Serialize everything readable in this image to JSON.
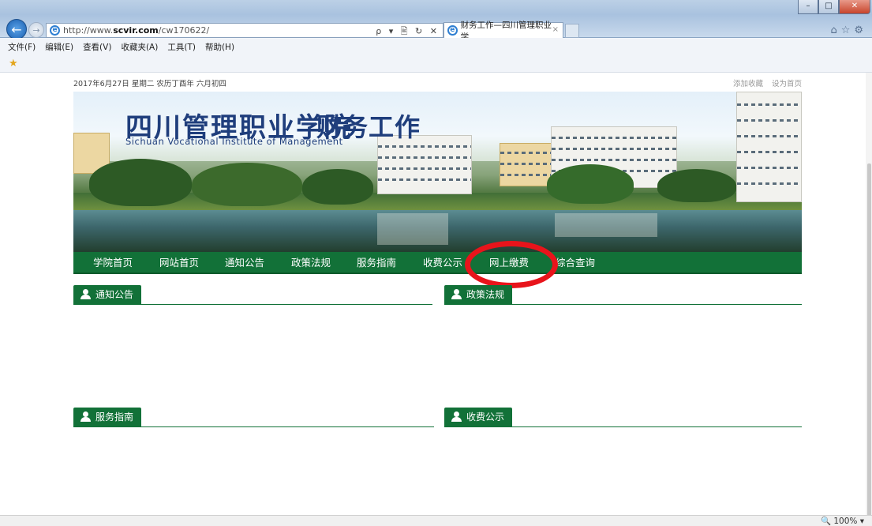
{
  "browser": {
    "url_prefix": "http://www.",
    "url_domain": "scvir.com",
    "url_path": "/cw170622/",
    "address_tools": "ρ ▾ 🖹 ↻ ✕",
    "tab_title": "财务工作—四川管理职业学...",
    "tab_close": "×",
    "menu": [
      "文件(F)",
      "编辑(E)",
      "查看(V)",
      "收藏夹(A)",
      "工具(T)",
      "帮助(H)"
    ],
    "right_icons": "⌂☆⚙",
    "zoom": "🔍 100%  ▾",
    "window_buttons": [
      "–",
      "□",
      "✕"
    ]
  },
  "page": {
    "date": "2017年6月27日 星期二 农历丁酉年 六月初四",
    "top_links": [
      "添加收藏",
      "设为首页"
    ],
    "banner": {
      "title": "四川管理职业学院",
      "subtitle": "Sichuan  Vocational  Institute  of  Management",
      "section_title": "财务工作"
    },
    "nav": [
      "学院首页",
      "网站首页",
      "通知公告",
      "政策法规",
      "服务指南",
      "收费公示",
      "网上缴费",
      "综合查询"
    ],
    "sections": [
      "通知公告",
      "政策法规",
      "服务指南",
      "收费公示"
    ],
    "highlighted_nav": "网上缴费",
    "colors": {
      "nav_green": "#127138",
      "highlight_red": "#e8141b",
      "title_blue": "#1f3e7c"
    }
  }
}
